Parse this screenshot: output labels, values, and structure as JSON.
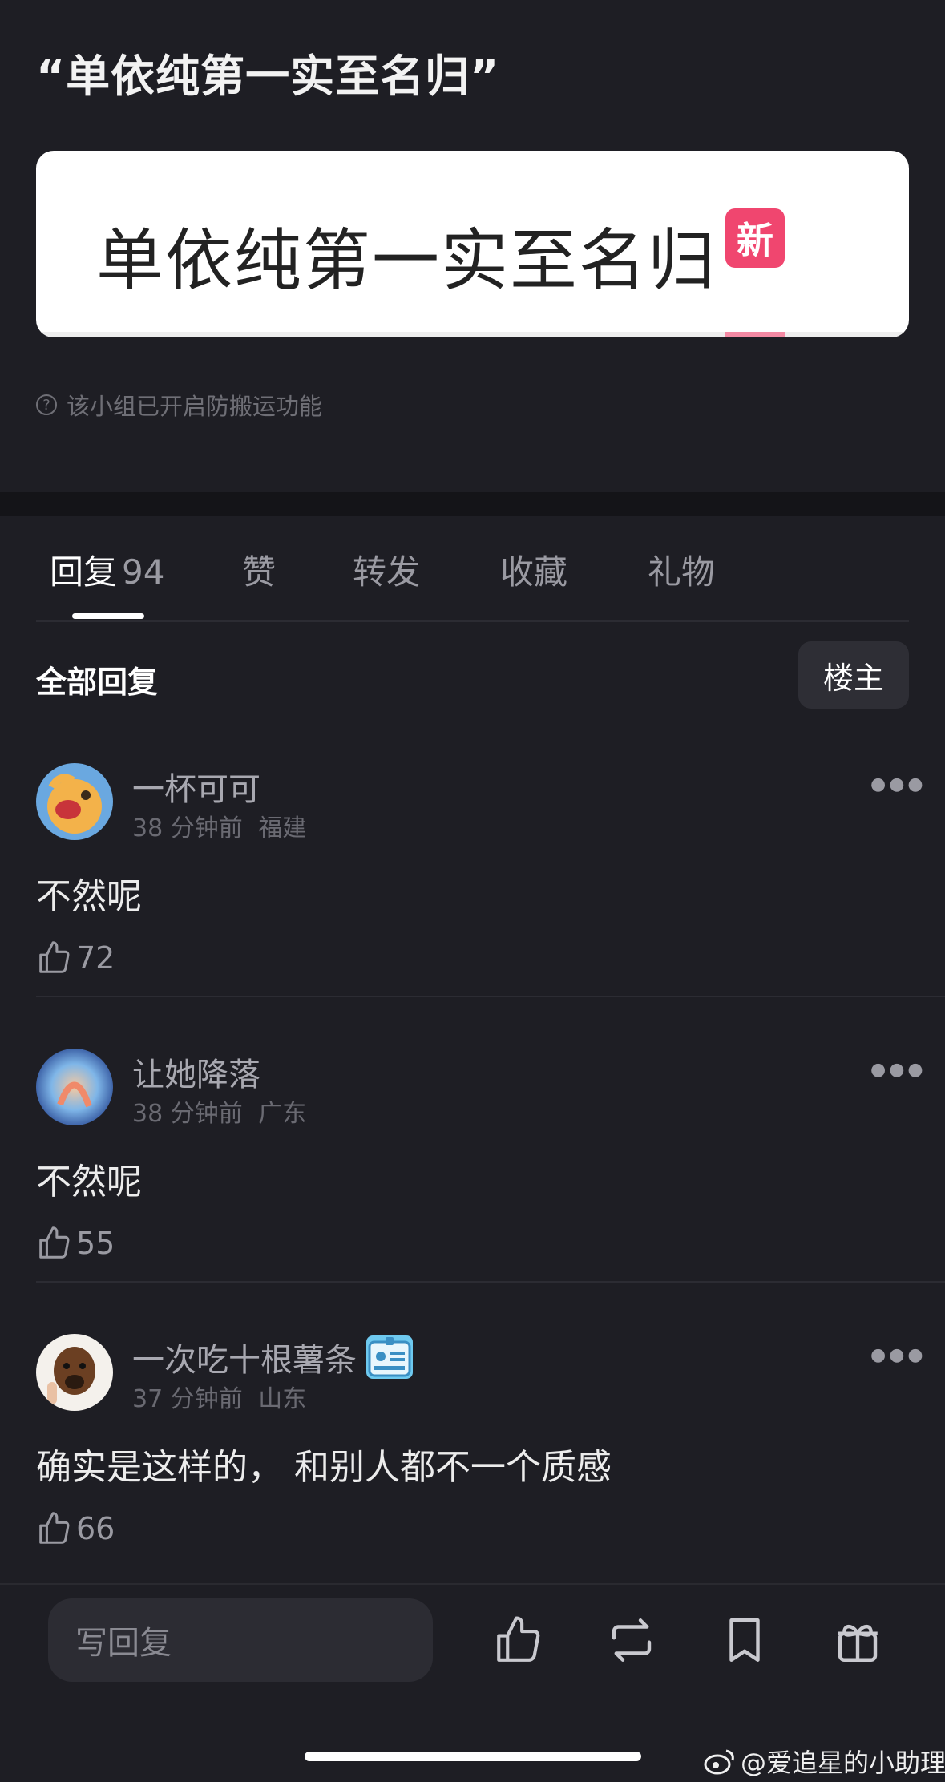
{
  "post": {
    "title": "“单依纯第一实至名归”",
    "image_text": "单依纯第一实至名归",
    "image_badge": "新",
    "note": "该小组已开启防搬运功能"
  },
  "tabs": [
    {
      "label": "回复",
      "count": "94",
      "active": true
    },
    {
      "label": "赞"
    },
    {
      "label": "转发"
    },
    {
      "label": "收藏"
    },
    {
      "label": "礼物"
    }
  ],
  "replies_header": {
    "title": "全部回复",
    "owner_button": "楼主"
  },
  "comments": [
    {
      "user": "一杯可可",
      "time": "38 分钟前",
      "location": "福建",
      "text": "不然呢",
      "likes": "72"
    },
    {
      "user": "让她降落",
      "time": "38 分钟前",
      "location": "广东",
      "text": "不然呢",
      "likes": "55"
    },
    {
      "user": "一次吃十根薯条",
      "time": "37 分钟前",
      "location": "山东",
      "text": "确实是这样的， 和别人都不一个质感",
      "likes": "66"
    }
  ],
  "bottom_bar": {
    "reply_placeholder": "写回复",
    "icons": [
      "like-icon",
      "repost-icon",
      "bookmark-icon",
      "gift-icon"
    ]
  },
  "watermark": "@爱追星的小助理",
  "colors": {
    "background": "#1e1e24",
    "badge_pink": "#f0466f",
    "card": "#ffffff"
  }
}
